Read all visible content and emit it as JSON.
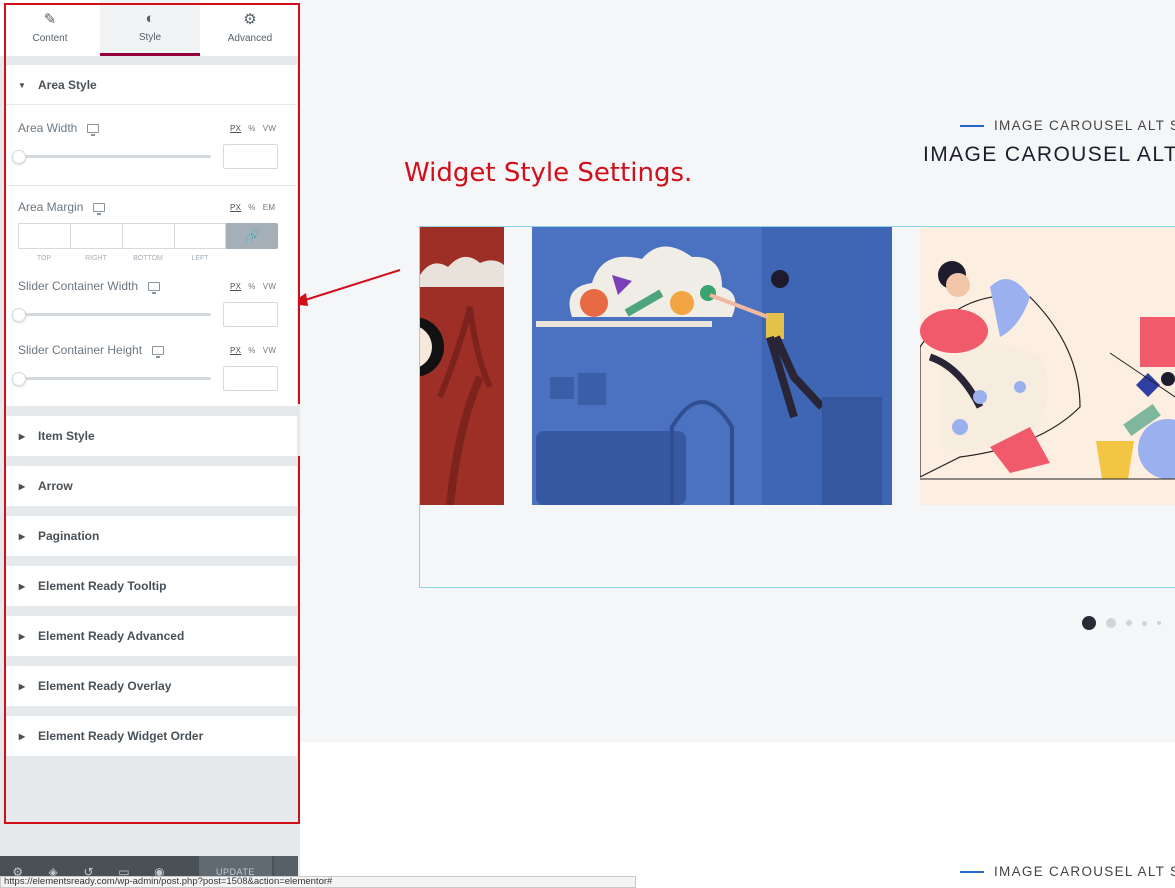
{
  "tabs": [
    {
      "label": "Content",
      "icon": "pencil-icon"
    },
    {
      "label": "Style",
      "icon": "contrast-icon"
    },
    {
      "label": "Advanced",
      "icon": "gear-icon"
    }
  ],
  "area_style": {
    "title": "Area Style",
    "area_width": {
      "label": "Area Width",
      "units": [
        "PX",
        "%",
        "VW"
      ],
      "value": ""
    },
    "area_margin": {
      "label": "Area Margin",
      "units": [
        "PX",
        "%",
        "EM"
      ],
      "dims": [
        "TOP",
        "RIGHT",
        "BOTTOM",
        "LEFT"
      ]
    },
    "slider_container_width": {
      "label": "Slider Container Width",
      "units": [
        "PX",
        "%",
        "VW"
      ],
      "value": ""
    },
    "slider_container_height": {
      "label": "Slider Container Height",
      "units": [
        "PX",
        "%",
        "VW"
      ],
      "value": ""
    }
  },
  "sections": [
    "Item Style",
    "Arrow",
    "Pagination",
    "Element Ready Tooltip",
    "Element Ready Advanced",
    "Element Ready Overlay",
    "Element Ready Widget Order"
  ],
  "bottom_bar": {
    "update_label": "UPDATE",
    "icons": [
      "settings-icon",
      "layers-icon",
      "history-icon",
      "responsive-icon",
      "preview-eye-icon"
    ]
  },
  "preview": {
    "subtitle": "IMAGE CAROUSEL ALT ST",
    "title": "IMAGE CAROUSEL ALT ST",
    "annotation": "Widget Style Settings.",
    "subtitle_bottom": "IMAGE CAROUSEL ALT ST",
    "pagination": {
      "total": 5,
      "active": 1
    }
  },
  "colors": {
    "accent": "#93003c",
    "annotation": "#d10f1b",
    "link_blue": "#2568c8"
  },
  "status_url": "https://elementsready.com/wp-admin/post.php?post=1508&action=elementor#"
}
